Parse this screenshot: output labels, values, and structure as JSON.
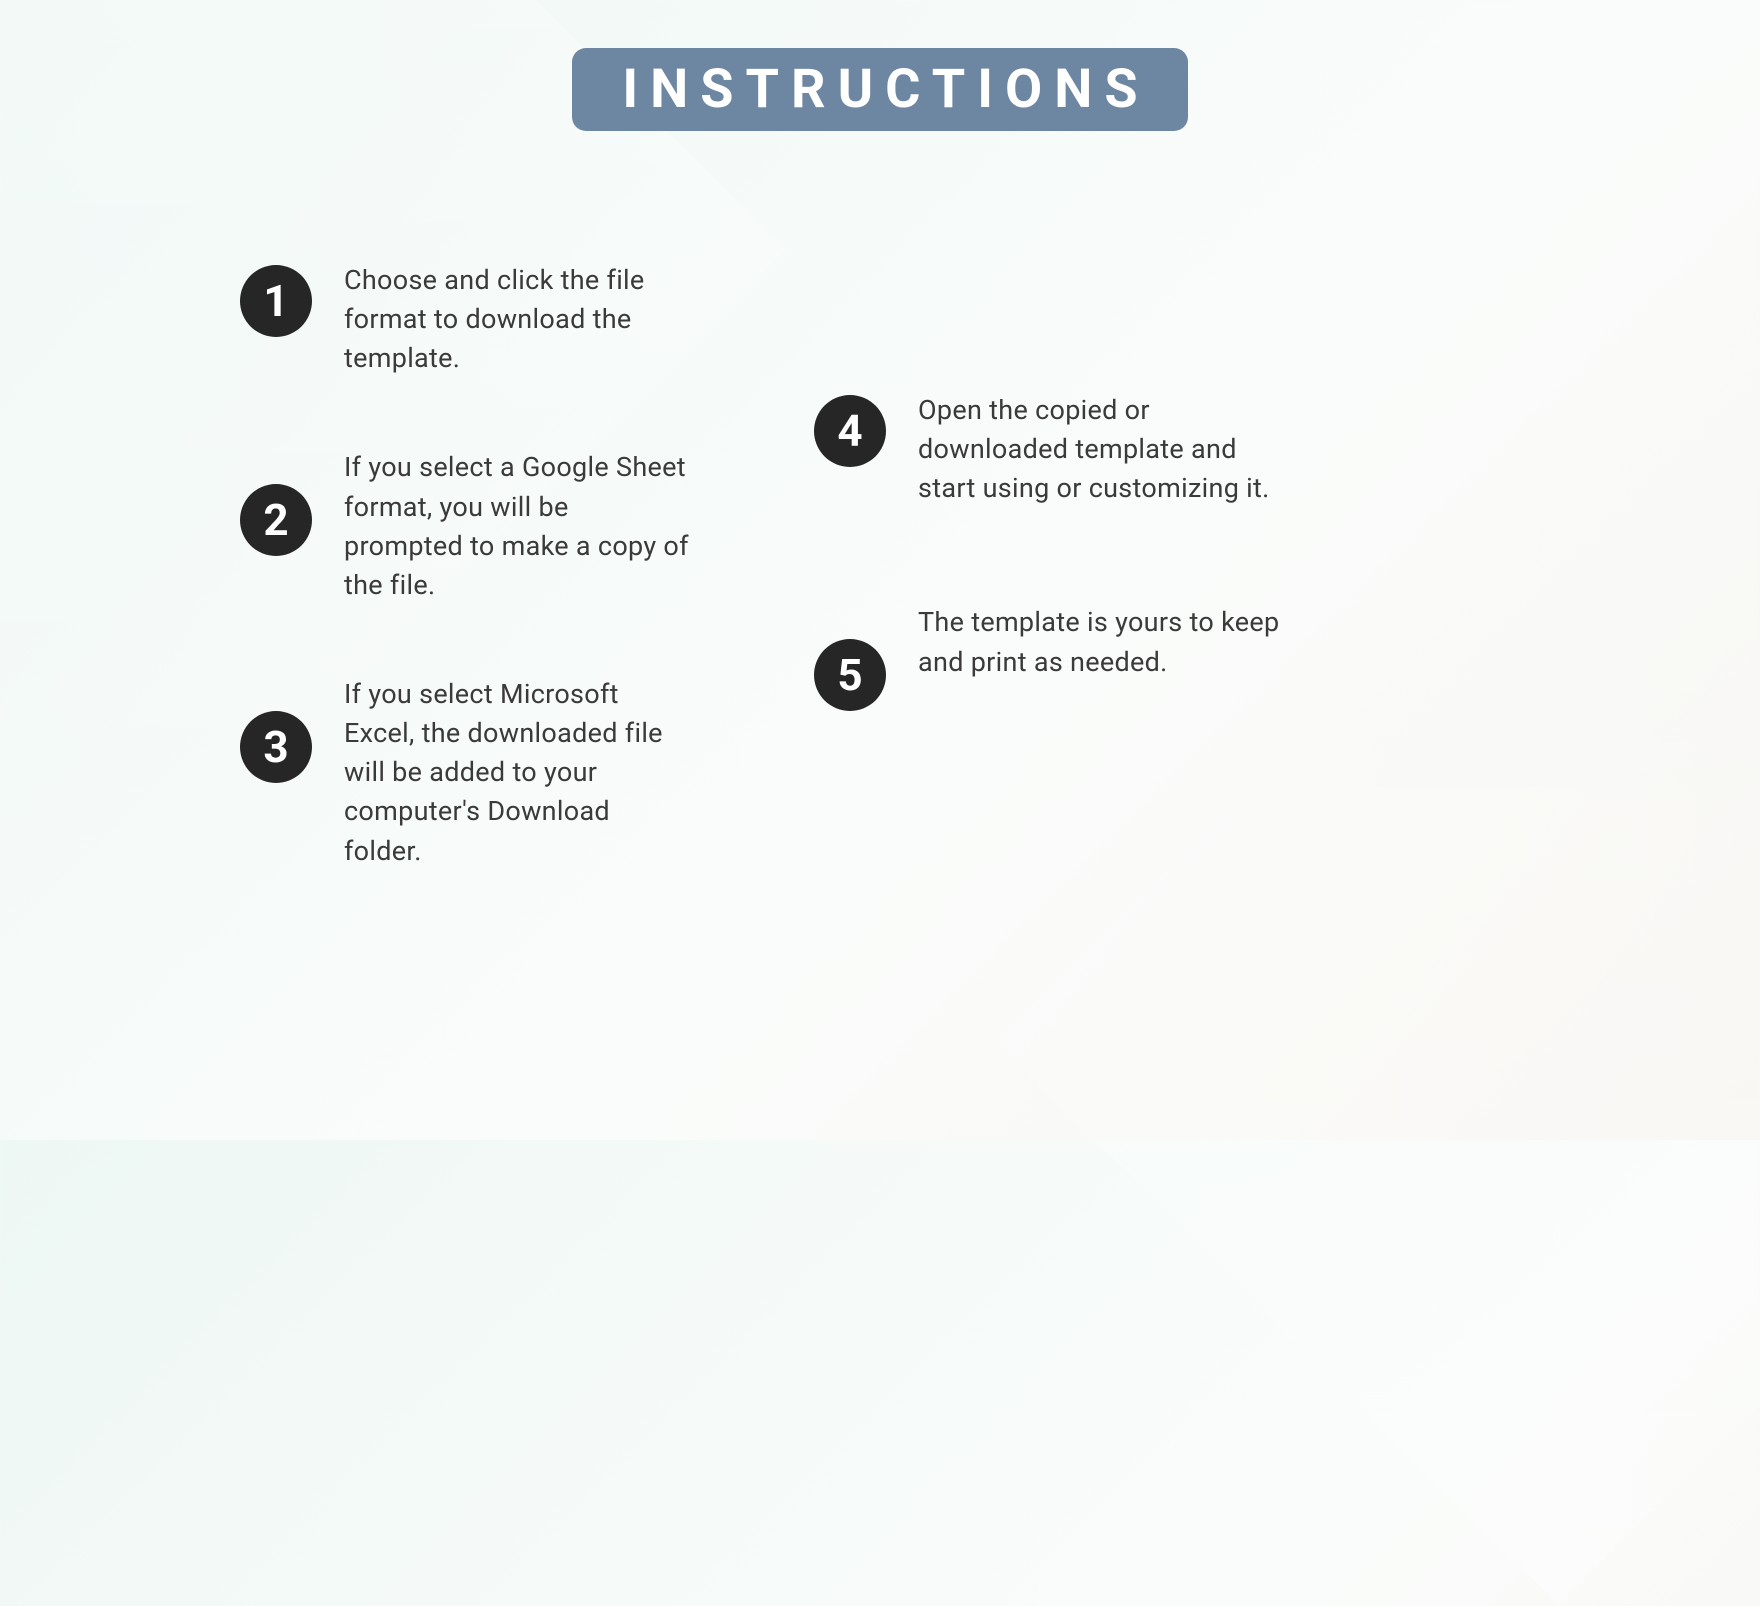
{
  "title": "INSTRUCTIONS",
  "colors": {
    "badge_bg": "#6d87a3",
    "badge_text": "#ffffff",
    "number_bg": "#262626",
    "number_text": "#ffffff",
    "body_text": "#3a3a3a"
  },
  "steps_left": [
    {
      "number": "1",
      "text": "Choose and click the file format to download the template."
    },
    {
      "number": "2",
      "text": "If you select a Google Sheet format, you will be prompted to make a copy of the file."
    },
    {
      "number": "3",
      "text": "If you select Microsoft Excel, the downloaded file will be added to your computer's Download  folder."
    }
  ],
  "steps_right": [
    {
      "number": "4",
      "text": "Open the copied or downloaded template and start using or customizing it."
    },
    {
      "number": "5",
      "text": "The template is yours to keep and print as needed."
    }
  ]
}
